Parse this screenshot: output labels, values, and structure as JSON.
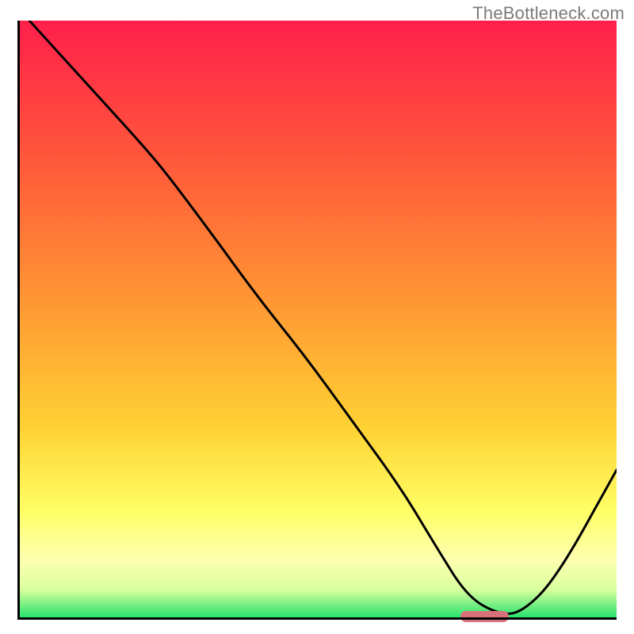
{
  "watermark": "TheBottleneck.com",
  "colors": {
    "gradient_top": "#ff1f4b",
    "gradient_mid1": "#ff7a33",
    "gradient_mid2": "#ffd233",
    "gradient_mid3": "#ffff7a",
    "gradient_bottom": "#18e06a",
    "curve": "#000000",
    "axis": "#000000",
    "marker": "#d9717a",
    "watermark": "#7a7a7a"
  },
  "chart_data": {
    "type": "line",
    "title": "",
    "xlabel": "",
    "ylabel": "",
    "xlim": [
      0,
      100
    ],
    "ylim": [
      0,
      100
    ],
    "grid": false,
    "legend": false,
    "x": [
      2,
      12,
      22,
      26,
      32,
      40,
      48,
      56,
      64,
      70,
      75,
      80,
      84,
      90,
      100
    ],
    "values": [
      100,
      89,
      78,
      73,
      65,
      54,
      44,
      33,
      22,
      12,
      4,
      1,
      1,
      7,
      25
    ],
    "annotations": [
      {
        "type": "marker",
        "shape": "pill",
        "x_start": 74,
        "x_end": 82,
        "y": 0.5
      }
    ],
    "background": "vertical-gradient red→orange→yellow→green"
  }
}
